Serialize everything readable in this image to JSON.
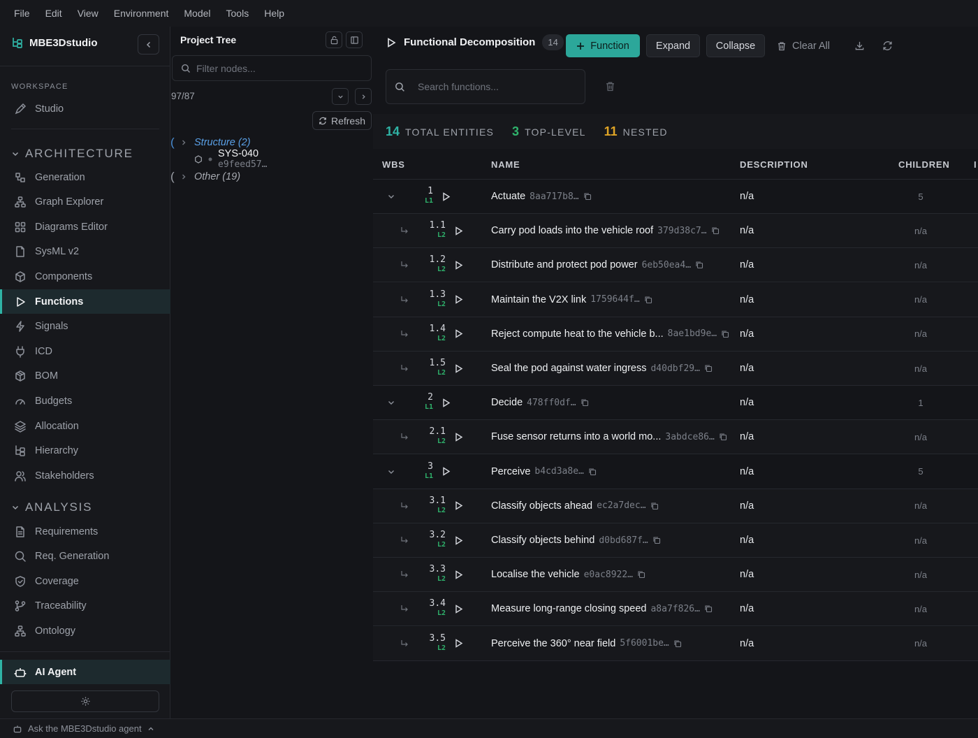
{
  "menu": [
    "File",
    "Edit",
    "View",
    "Environment",
    "Model",
    "Tools",
    "Help"
  ],
  "sidebar": {
    "brand": "MBE3Dstudio",
    "workspace_label": "WORKSPACE",
    "studio": "Studio",
    "architecture_label": "ARCHITECTURE",
    "architecture_items": [
      {
        "label": "Generation",
        "icon": "generation-icon"
      },
      {
        "label": "Graph Explorer",
        "icon": "graph-icon"
      },
      {
        "label": "Diagrams Editor",
        "icon": "diagrams-icon"
      },
      {
        "label": "SysML v2",
        "icon": "file-icon"
      },
      {
        "label": "Components",
        "icon": "cube-icon"
      },
      {
        "label": "Functions",
        "icon": "play-icon"
      },
      {
        "label": "Signals",
        "icon": "zap-icon"
      },
      {
        "label": "ICD",
        "icon": "plug-icon"
      },
      {
        "label": "BOM",
        "icon": "package-icon"
      },
      {
        "label": "Budgets",
        "icon": "gauge-icon"
      },
      {
        "label": "Allocation",
        "icon": "layers-icon"
      },
      {
        "label": "Hierarchy",
        "icon": "hierarchy-icon"
      },
      {
        "label": "Stakeholders",
        "icon": "users-icon"
      }
    ],
    "analysis_label": "ANALYSIS",
    "analysis_items": [
      {
        "label": "Requirements",
        "icon": "file-text-icon"
      },
      {
        "label": "Req. Generation",
        "icon": "search-icon"
      },
      {
        "label": "Coverage",
        "icon": "shield-check-icon"
      },
      {
        "label": "Traceability",
        "icon": "git-branch-icon"
      },
      {
        "label": "Ontology",
        "icon": "network-icon"
      }
    ],
    "ai_agent": "AI Agent"
  },
  "tree": {
    "title": "Project Tree",
    "filter_placeholder": "Filter nodes...",
    "count": "97/87",
    "refresh": "Refresh",
    "structure": "Structure (2)",
    "sys_name": "SYS-040",
    "sys_id": "e9feed57…",
    "other": "Other (19)"
  },
  "main": {
    "title": "Functional Decomposition",
    "count_badge": "14",
    "add_function": "Function",
    "expand": "Expand",
    "collapse": "Collapse",
    "clear_all": "Clear All",
    "search_placeholder": "Search functions...",
    "stats": {
      "total": "14",
      "total_label": "TOTAL ENTITIES",
      "top": "3",
      "top_label": "TOP-LEVEL",
      "nested": "11",
      "nested_label": "NESTED"
    },
    "columns": [
      "WBS",
      "NAME",
      "DESCRIPTION",
      "CHILDREN",
      "I"
    ],
    "rows": [
      {
        "wbs": "1",
        "level": "L1",
        "name": "Actuate",
        "id": "8aa717b8…",
        "desc": "n/a",
        "children": "5"
      },
      {
        "wbs": "1.1",
        "level": "L2",
        "name": "Carry pod loads into the vehicle roof",
        "id": "379d38c7…",
        "desc": "n/a",
        "children": "n/a"
      },
      {
        "wbs": "1.2",
        "level": "L2",
        "name": "Distribute and protect pod power",
        "id": "6eb50ea4…",
        "desc": "n/a",
        "children": "n/a"
      },
      {
        "wbs": "1.3",
        "level": "L2",
        "name": "Maintain the V2X link",
        "id": "1759644f…",
        "desc": "n/a",
        "children": "n/a"
      },
      {
        "wbs": "1.4",
        "level": "L2",
        "name": "Reject compute heat to the vehicle b...",
        "id": "8ae1bd9e…",
        "desc": "n/a",
        "children": "n/a"
      },
      {
        "wbs": "1.5",
        "level": "L2",
        "name": "Seal the pod against water ingress",
        "id": "d40dbf29…",
        "desc": "n/a",
        "children": "n/a"
      },
      {
        "wbs": "2",
        "level": "L1",
        "name": "Decide",
        "id": "478ff0df…",
        "desc": "n/a",
        "children": "1"
      },
      {
        "wbs": "2.1",
        "level": "L2",
        "name": "Fuse sensor returns into a world mo...",
        "id": "3abdce86…",
        "desc": "n/a",
        "children": "n/a"
      },
      {
        "wbs": "3",
        "level": "L1",
        "name": "Perceive",
        "id": "b4cd3a8e…",
        "desc": "n/a",
        "children": "5"
      },
      {
        "wbs": "3.1",
        "level": "L2",
        "name": "Classify objects ahead",
        "id": "ec2a7dec…",
        "desc": "n/a",
        "children": "n/a"
      },
      {
        "wbs": "3.2",
        "level": "L2",
        "name": "Classify objects behind",
        "id": "d0bd687f…",
        "desc": "n/a",
        "children": "n/a"
      },
      {
        "wbs": "3.3",
        "level": "L2",
        "name": "Localise the vehicle",
        "id": "e0ac8922…",
        "desc": "n/a",
        "children": "n/a"
      },
      {
        "wbs": "3.4",
        "level": "L2",
        "name": "Measure long-range closing speed",
        "id": "a8a7f826…",
        "desc": "n/a",
        "children": "n/a"
      },
      {
        "wbs": "3.5",
        "level": "L2",
        "name": "Perceive the 360° near field",
        "id": "5f6001be…",
        "desc": "n/a",
        "children": "n/a"
      }
    ]
  },
  "status": {
    "agent_prompt": "Ask the MBE3Dstudio agent"
  },
  "colors": {
    "accent": "#2ca79a",
    "level_green": "#2fb36c",
    "stat_nested": "#e0a526"
  }
}
